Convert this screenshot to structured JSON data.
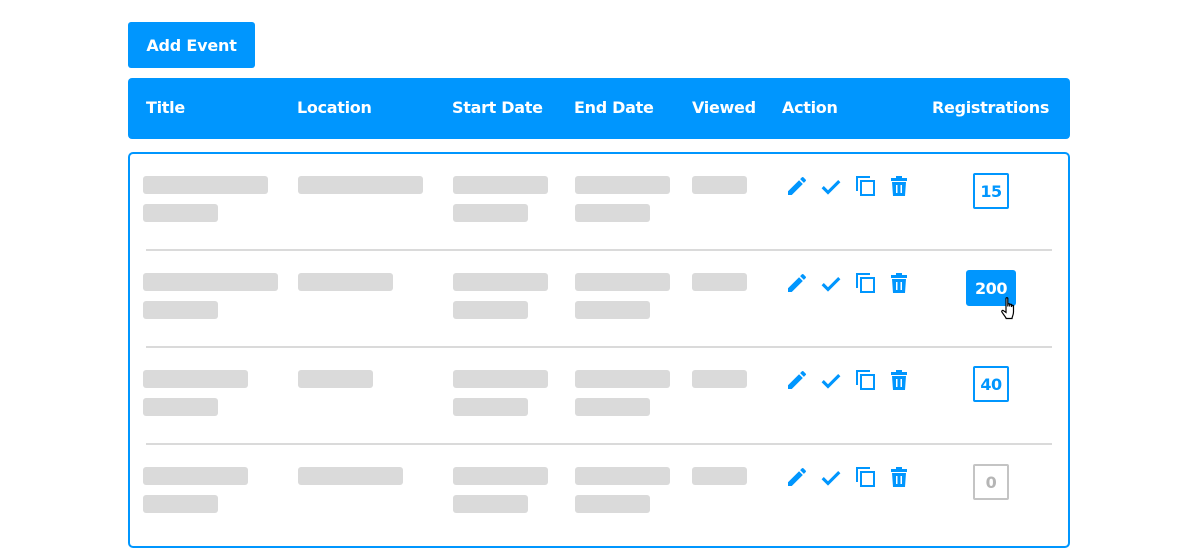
{
  "toolbar": {
    "add_event_label": "Add Event"
  },
  "table": {
    "columns": [
      "Title",
      "Location",
      "Start Date",
      "End Date",
      "Viewed",
      "Action",
      "Registrations"
    ],
    "rows": [
      {
        "registrations": "15",
        "registrations_state": "default"
      },
      {
        "registrations": "200",
        "registrations_state": "hover"
      },
      {
        "registrations": "40",
        "registrations_state": "default"
      },
      {
        "registrations": "0",
        "registrations_state": "empty"
      }
    ],
    "row_actions": [
      "edit-icon",
      "check-icon",
      "copy-icon",
      "delete-icon"
    ]
  },
  "colors": {
    "primary": "#0096fe",
    "skeleton": "#dadada",
    "empty_badge": "#c4c4c4"
  }
}
